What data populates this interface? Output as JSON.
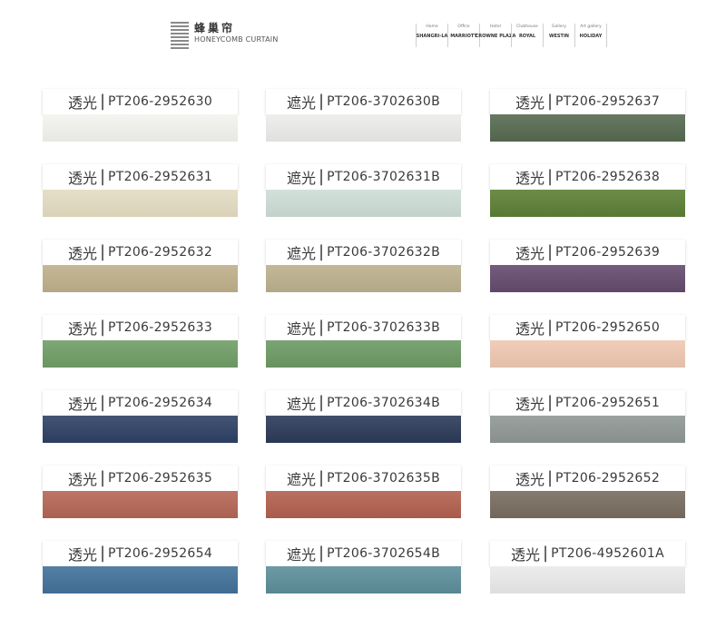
{
  "brand": {
    "name_cn": "蜂巢帘",
    "name_en": "HONEYCOMB CURTAIN"
  },
  "venues": [
    {
      "label": "Home",
      "logo": "SHANGRI-LA"
    },
    {
      "label": "Office",
      "logo": "MARRIOTT"
    },
    {
      "label": "Hotel",
      "logo": "CROWNE PLAZA"
    },
    {
      "label": "Clubhouse",
      "logo": "ROYAL"
    },
    {
      "label": "Gallery",
      "logo": "WESTIN"
    },
    {
      "label": "Art gallery",
      "logo": "HOLIDAY"
    }
  ],
  "swatches": [
    {
      "type": "透光",
      "code": "PT206-2952630",
      "color": "#f3f3ef"
    },
    {
      "type": "遮光",
      "code": "PT206-3702630B",
      "color": "#ececea"
    },
    {
      "type": "透光",
      "code": "PT206-2952637",
      "color": "#566a50"
    },
    {
      "type": "透光",
      "code": "PT206-2952631",
      "color": "#e4dcc2"
    },
    {
      "type": "遮光",
      "code": "PT206-3702631B",
      "color": "#cdddd5"
    },
    {
      "type": "透光",
      "code": "PT206-2952638",
      "color": "#5c7f35"
    },
    {
      "type": "透光",
      "code": "PT206-2952632",
      "color": "#bfb08a"
    },
    {
      "type": "遮光",
      "code": "PT206-3702632B",
      "color": "#bcb08d"
    },
    {
      "type": "透光",
      "code": "PT206-2952639",
      "color": "#644b6d"
    },
    {
      "type": "透光",
      "code": "PT206-2952633",
      "color": "#6f9e66"
    },
    {
      "type": "遮光",
      "code": "PT206-3702633B",
      "color": "#6c9a64"
    },
    {
      "type": "透光",
      "code": "PT206-2952650",
      "color": "#efc8b2"
    },
    {
      "type": "透光",
      "code": "PT206-2952634",
      "color": "#2e4165"
    },
    {
      "type": "遮光",
      "code": "PT206-3702634B",
      "color": "#2b3a58"
    },
    {
      "type": "透光",
      "code": "PT206-2952651",
      "color": "#8f9794"
    },
    {
      "type": "透光",
      "code": "PT206-2952635",
      "color": "#b56655"
    },
    {
      "type": "遮光",
      "code": "PT206-3702635B",
      "color": "#b2604f"
    },
    {
      "type": "透光",
      "code": "PT206-2952652",
      "color": "#786c5f"
    },
    {
      "type": "透光",
      "code": "PT206-2952654",
      "color": "#42719a"
    },
    {
      "type": "遮光",
      "code": "PT206-3702654B",
      "color": "#5c8e9a"
    },
    {
      "type": "透光",
      "code": "PT206-4952601A",
      "color": "#eaeaea"
    }
  ]
}
